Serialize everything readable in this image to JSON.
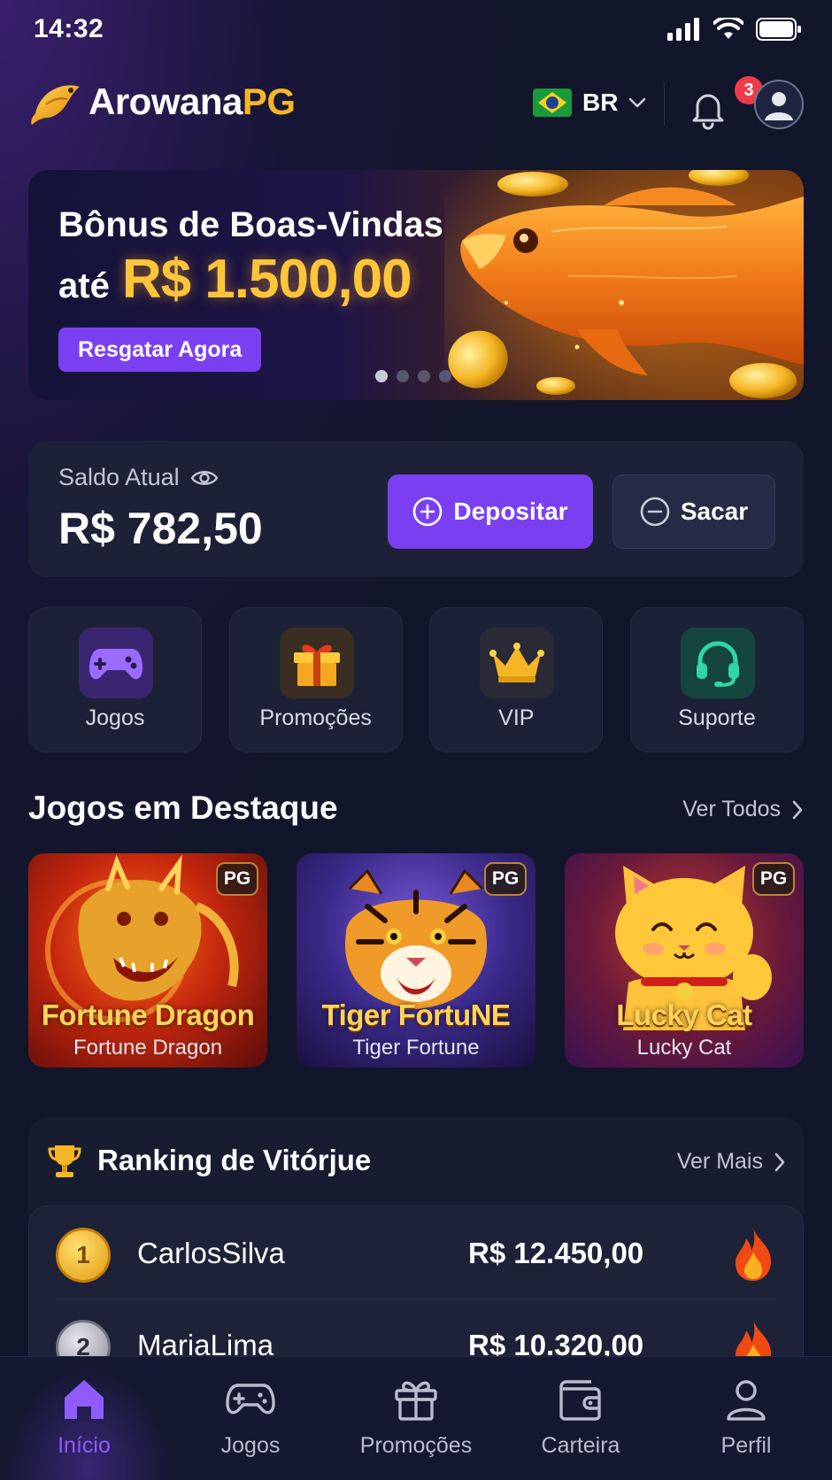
{
  "status_bar": {
    "time": "14:32"
  },
  "header": {
    "logo_main": "Arowana",
    "logo_accent": "PG",
    "language": "BR",
    "notification_count": "3"
  },
  "banner": {
    "title": "Bônus de Boas-Vindas",
    "prefix": "até",
    "amount": "R$ 1.500,00",
    "cta_label": "Resgatar Agora",
    "slide_count": 4,
    "active_slide": 1
  },
  "balance": {
    "label": "Saldo Atual",
    "value": "R$ 782,50",
    "deposit_label": "Depositar",
    "withdraw_label": "Sacar"
  },
  "quick_actions": [
    {
      "label": "Jogos",
      "icon": "gamepad-icon",
      "color": "#8b5cf6"
    },
    {
      "label": "Promoções",
      "icon": "gift-icon",
      "color": "#f5b625"
    },
    {
      "label": "VIP",
      "icon": "crown-icon",
      "color": "#f5b625"
    },
    {
      "label": "Suporte",
      "icon": "headset-icon",
      "color": "#2fd6a8"
    }
  ],
  "featured": {
    "title": "Jogos em Destaque",
    "link_label": "Ver Todos",
    "games": [
      {
        "logo": "Fortune Dragon",
        "name": "Fortune Dragon",
        "badge": "PG"
      },
      {
        "logo": "Tiger FortuNE",
        "name": "Tiger Fortune",
        "badge": "PG"
      },
      {
        "logo": "Lucky Cat",
        "name": "Lucky Cat",
        "badge": "PG"
      }
    ]
  },
  "ranking": {
    "title": "Ranking de Vitórjue",
    "link_label": "Ver Mais",
    "rows": [
      {
        "rank": "1",
        "name": "CarlosSilva",
        "amount": "R$ 12.450,00"
      },
      {
        "rank": "2",
        "name": "MariaLima",
        "amount": "R$ 10.320,00"
      }
    ]
  },
  "bottom_nav": [
    {
      "label": "Início",
      "icon": "home-icon",
      "active": true
    },
    {
      "label": "Jogos",
      "icon": "gamepad-icon",
      "active": false
    },
    {
      "label": "Promoções",
      "icon": "gift-icon",
      "active": false
    },
    {
      "label": "Carteira",
      "icon": "wallet-icon",
      "active": false
    },
    {
      "label": "Perfil",
      "icon": "user-icon",
      "active": false
    }
  ],
  "colors": {
    "accent": "#7b3ff2",
    "gold": "#f5b625",
    "background": "#12162a",
    "card": "#1c2138"
  }
}
